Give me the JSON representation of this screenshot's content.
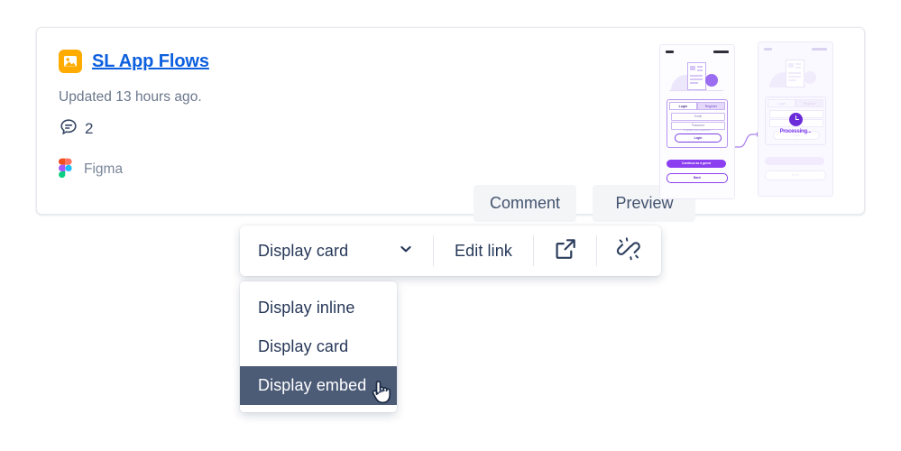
{
  "card": {
    "icon_name": "image-placeholder-icon",
    "title": "SL App Flows",
    "title_color": "#0c5fde",
    "icon_bg": "#ffab00",
    "updated": "Updated 13 hours ago.",
    "comment_icon": "comment-bubble-icon",
    "comment_count": "2",
    "provider_icon": "figma-logo-icon",
    "provider": "Figma",
    "actions": [
      {
        "label": "Comment",
        "name": "comment-button"
      },
      {
        "label": "Preview",
        "name": "preview-button"
      }
    ]
  },
  "preview": {
    "left_phone": {
      "tab_login": "Login",
      "tab_register": "Register",
      "field_email": "Email",
      "field_password": "Password",
      "forgot": "Forgotten your password?",
      "login_button": "Login",
      "guest_button": "Continue as a guest",
      "back_button": "Back"
    },
    "right_phone": {
      "processing_label": "Processing...",
      "clock_icon": "clock-icon"
    }
  },
  "toolbar": {
    "display_mode": "Display card",
    "chevron_icon": "chevron-down-icon",
    "edit_link": "Edit link",
    "open_icon": "open-in-new-window-icon",
    "unlink_icon": "unlink-icon"
  },
  "menu": {
    "items": [
      {
        "label": "Display inline",
        "selected": false
      },
      {
        "label": "Display card",
        "selected": false
      },
      {
        "label": "Display embed",
        "selected": true
      }
    ],
    "selected_bg": "#4c5c77",
    "cursor_icon": "pointer-hand-cursor"
  }
}
